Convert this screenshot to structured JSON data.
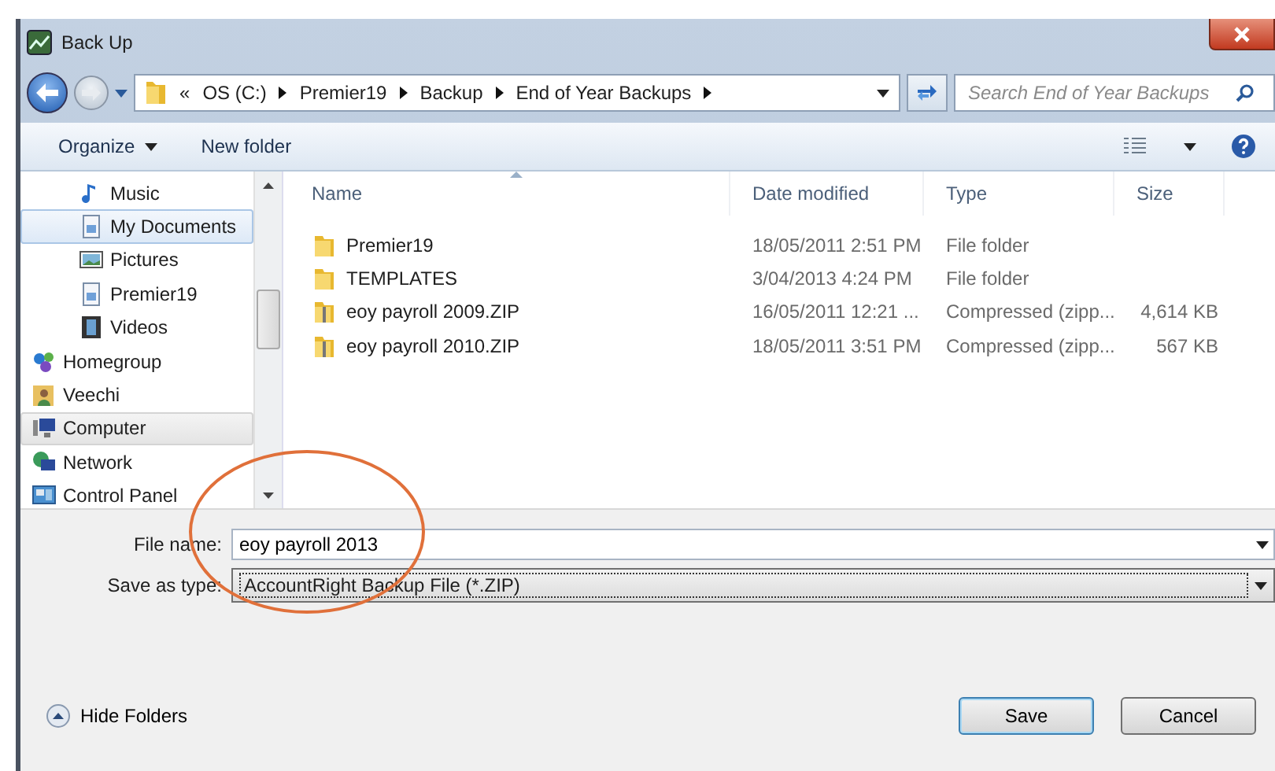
{
  "window": {
    "title": "Back Up"
  },
  "address_bar": {
    "overflow": "«",
    "crumbs": [
      "OS (C:)",
      "Premier19",
      "Backup",
      "End of Year Backups"
    ]
  },
  "search": {
    "placeholder": "Search End of Year Backups"
  },
  "toolbar": {
    "organize": "Organize",
    "new_folder": "New folder"
  },
  "sidebar": {
    "items": [
      {
        "label": "Music",
        "kind": "music",
        "child": true,
        "selected": false,
        "hover": false
      },
      {
        "label": "My Documents",
        "kind": "documents",
        "child": true,
        "selected": true,
        "hover": false
      },
      {
        "label": "Pictures",
        "kind": "pictures",
        "child": true,
        "selected": false,
        "hover": false
      },
      {
        "label": "Premier19",
        "kind": "documents",
        "child": true,
        "selected": false,
        "hover": false
      },
      {
        "label": "Videos",
        "kind": "videos",
        "child": true,
        "selected": false,
        "hover": false
      },
      {
        "label": "Homegroup",
        "kind": "homegroup",
        "child": false,
        "selected": false,
        "hover": false
      },
      {
        "label": "Veechi",
        "kind": "user",
        "child": false,
        "selected": false,
        "hover": false
      },
      {
        "label": "Computer",
        "kind": "computer",
        "child": false,
        "selected": false,
        "hover": true
      },
      {
        "label": "Network",
        "kind": "network",
        "child": false,
        "selected": false,
        "hover": false
      },
      {
        "label": "Control Panel",
        "kind": "control",
        "child": false,
        "selected": false,
        "hover": false
      }
    ]
  },
  "table": {
    "columns": [
      "Name",
      "Date modified",
      "Type",
      "Size"
    ],
    "rows": [
      {
        "kind": "folder",
        "name": "Premier19",
        "date": "18/05/2011 2:51 PM",
        "type": "File folder"
      },
      {
        "kind": "folder",
        "name": "TEMPLATES",
        "date": "3/04/2013 4:24 PM",
        "type": "File folder"
      },
      {
        "kind": "zip",
        "name": "eoy payroll 2009.ZIP",
        "date": "16/05/2011 12:21 ...",
        "type": "Compressed (zipp...",
        "size": "4,614 KB"
      },
      {
        "kind": "zip",
        "name": "eoy payroll 2010.ZIP",
        "date": "18/05/2011 3:51 PM",
        "type": "Compressed (zipp...",
        "size": "567 KB"
      }
    ]
  },
  "file_name": {
    "label": "File name:",
    "value": "eoy payroll 2013"
  },
  "save_type": {
    "label": "Save as type:",
    "value": "AccountRight Backup File (*.ZIP)"
  },
  "hide_folders": "Hide Folders",
  "buttons": [
    "Save",
    "Cancel"
  ]
}
